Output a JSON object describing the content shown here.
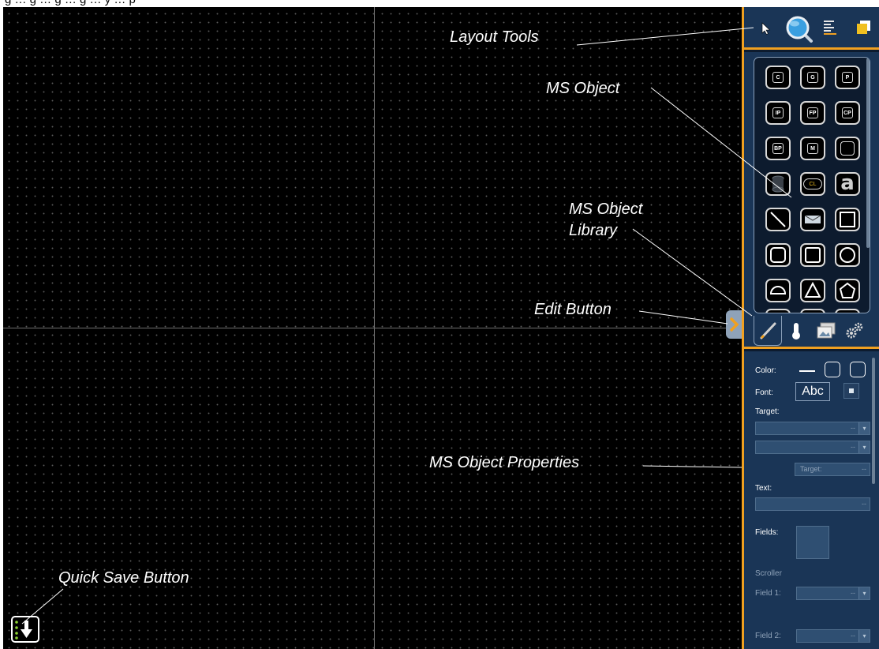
{
  "page": {
    "caption_fragment": "g … g … g … g … y … p"
  },
  "callouts": {
    "layout_tools": "Layout Tools",
    "ms_object": "MS Object",
    "ms_object_library_line1": "MS Object",
    "ms_object_library_line2": "Library",
    "edit_button": "Edit Button",
    "ms_object_properties": "MS Object Properties",
    "quick_save_button": "Quick Save Button"
  },
  "layout_tools": {
    "icons": [
      "pointer-icon",
      "magnifier-icon",
      "align-lines-icon",
      "layers-icon"
    ]
  },
  "library": {
    "rows": [
      [
        {
          "kind": "mini",
          "label": "C"
        },
        {
          "kind": "mini",
          "label": "G"
        },
        {
          "kind": "mini",
          "label": "P"
        }
      ],
      [
        {
          "kind": "mini",
          "label": "IP"
        },
        {
          "kind": "mini",
          "label": "FP"
        },
        {
          "kind": "mini",
          "label": "CP"
        }
      ],
      [
        {
          "kind": "mini",
          "label": "BP"
        },
        {
          "kind": "mini",
          "label": "M"
        },
        {
          "kind": "mini",
          "label": ""
        }
      ],
      [
        {
          "kind": "shape",
          "icon": "cylinder-icon"
        },
        {
          "kind": "shape",
          "icon": "command-line-icon",
          "label": "CL"
        },
        {
          "kind": "text",
          "label": "a"
        }
      ],
      [
        {
          "kind": "shape",
          "icon": "line-icon"
        },
        {
          "kind": "shape",
          "icon": "image-icon"
        },
        {
          "kind": "shape",
          "icon": "square-icon"
        }
      ],
      [
        {
          "kind": "shape",
          "icon": "rounded-rect-icon"
        },
        {
          "kind": "shape",
          "icon": "rect-icon"
        },
        {
          "kind": "shape",
          "icon": "circle-icon"
        }
      ],
      [
        {
          "kind": "shape",
          "icon": "semicircle-icon"
        },
        {
          "kind": "shape",
          "icon": "triangle-icon"
        },
        {
          "kind": "shape",
          "icon": "pentagon-icon"
        }
      ]
    ],
    "tabs": [
      "edit-tab-icon",
      "thermometer-tab-icon",
      "images-tab-icon",
      "gears-tab-icon"
    ]
  },
  "properties": {
    "color_label": "Color:",
    "font_label": "Font:",
    "font_sample": "Abc",
    "target_label": "Target:",
    "sub_target_label": "Target:",
    "text_label": "Text:",
    "fields_label": "Fields:",
    "scroller_label": "Scroller",
    "field1_label": "Field 1:",
    "field2_label": "Field 2:",
    "empty_value": "--",
    "dropdown_arrow": "▾"
  },
  "colors": {
    "accent": "#f0a020",
    "panel": "#1a3556",
    "canvas": "#000000"
  }
}
